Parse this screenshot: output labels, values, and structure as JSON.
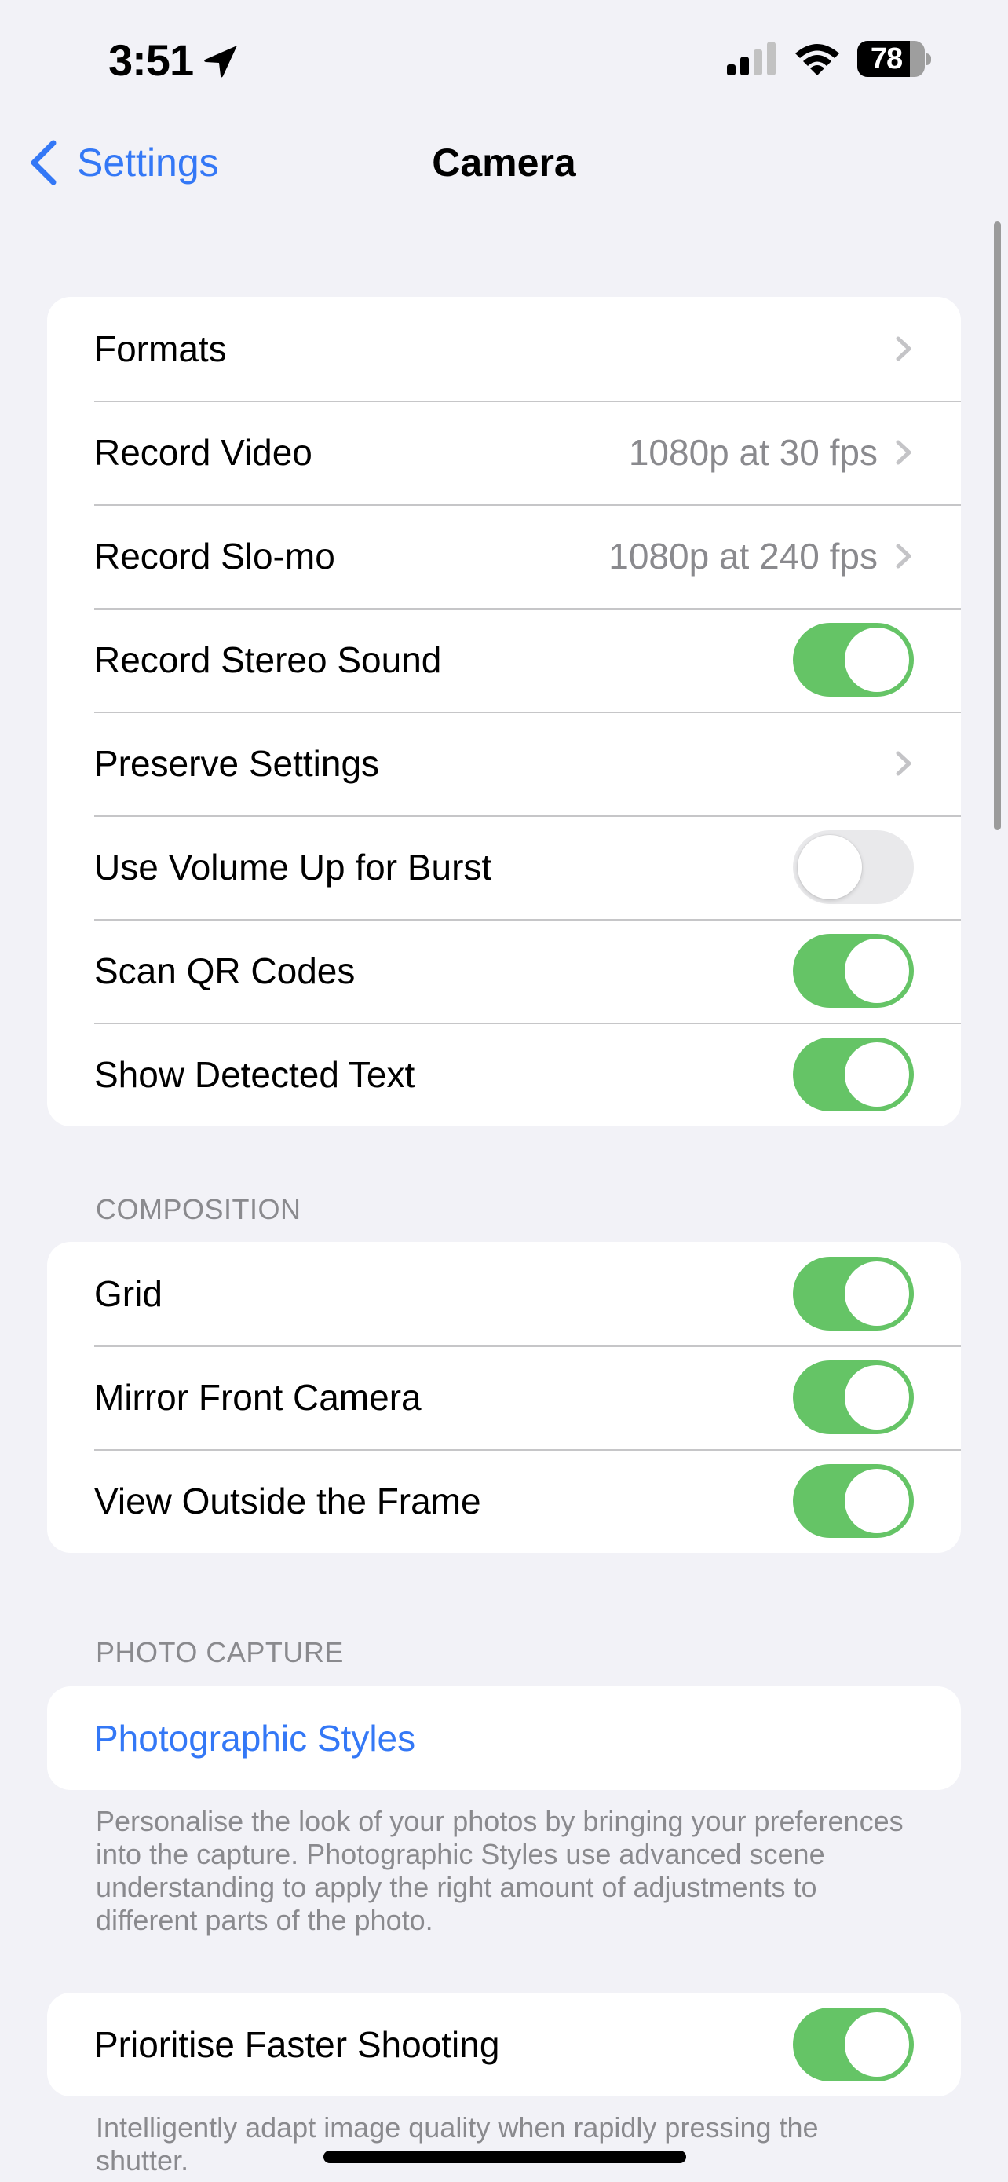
{
  "status_bar": {
    "time": "3:51",
    "location_icon": "location-arrow-icon",
    "signal_bars_active": 2,
    "signal_bars_total": 4,
    "wifi_icon": "wifi-icon",
    "battery_percent": 78
  },
  "nav": {
    "back_label": "Settings",
    "back_icon": "chevron-left-icon",
    "title": "Camera"
  },
  "colors": {
    "accent": "#3478F6",
    "toggle_on": "#65C466",
    "toggle_off": "#E9E9EB",
    "background": "#F2F2F7",
    "secondary_text": "#8A8A8E"
  },
  "groups": {
    "main": {
      "rows": [
        {
          "label": "Formats",
          "type": "link"
        },
        {
          "label": "Record Video",
          "value": "1080p at 30 fps",
          "type": "link"
        },
        {
          "label": "Record Slo-mo",
          "value": "1080p at 240 fps",
          "type": "link"
        },
        {
          "label": "Record Stereo Sound",
          "type": "toggle",
          "on": true
        },
        {
          "label": "Preserve Settings",
          "type": "link"
        },
        {
          "label": "Use Volume Up for Burst",
          "type": "toggle",
          "on": false
        },
        {
          "label": "Scan QR Codes",
          "type": "toggle",
          "on": true
        },
        {
          "label": "Show Detected Text",
          "type": "toggle",
          "on": true
        }
      ]
    },
    "composition": {
      "header": "COMPOSITION",
      "rows": [
        {
          "label": "Grid",
          "type": "toggle",
          "on": true
        },
        {
          "label": "Mirror Front Camera",
          "type": "toggle",
          "on": true
        },
        {
          "label": "View Outside the Frame",
          "type": "toggle",
          "on": true
        }
      ]
    },
    "photo_capture": {
      "header": "PHOTO CAPTURE",
      "rows": [
        {
          "label": "Photographic Styles",
          "type": "button"
        }
      ],
      "footer": "Personalise the look of your photos by bringing your preferences into the capture. Photographic Styles use advanced scene understanding to apply the right amount of adjustments to different parts of the photo."
    },
    "faster_shooting": {
      "rows": [
        {
          "label": "Prioritise Faster Shooting",
          "type": "toggle",
          "on": true
        }
      ],
      "footer": "Intelligently adapt image quality when rapidly pressing the shutter."
    }
  }
}
